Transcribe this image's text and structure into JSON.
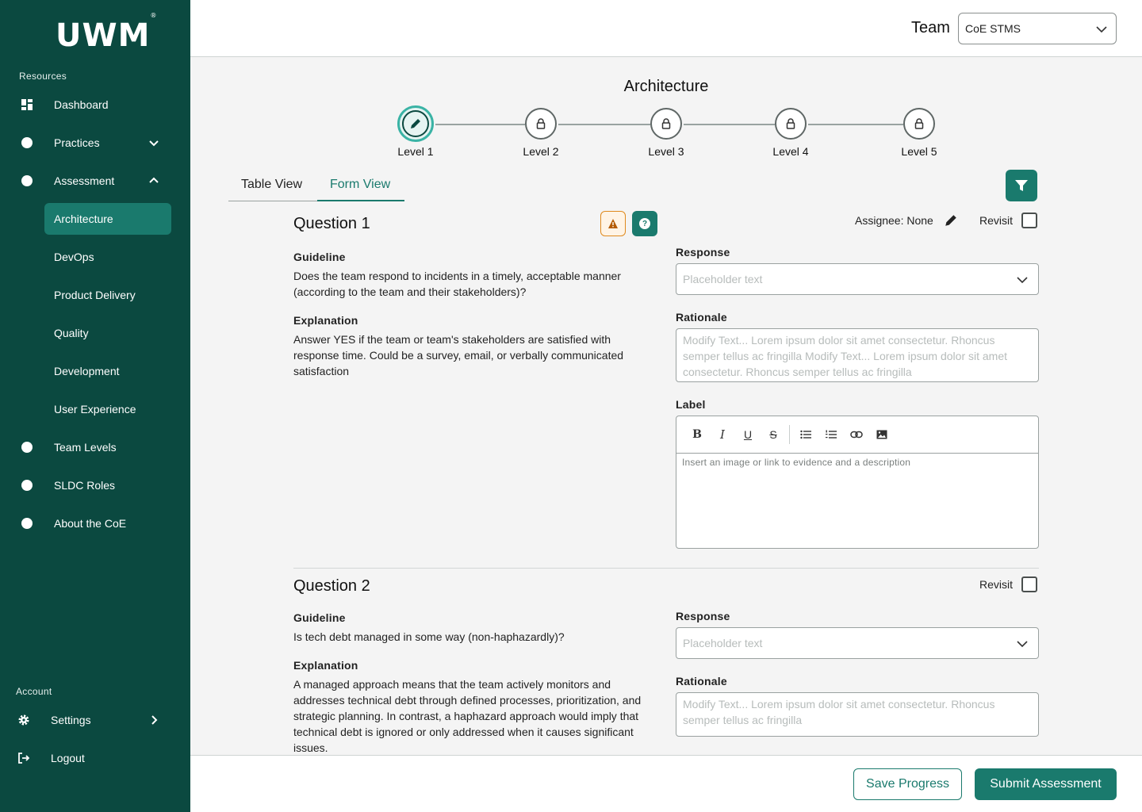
{
  "brand": {
    "logo_text": "UWM",
    "logo_mark": "®"
  },
  "sidebar": {
    "resources_label": "Resources",
    "account_label": "Account",
    "items": [
      {
        "label": "Dashboard",
        "icon": "dashboard-icon"
      },
      {
        "label": "Practices",
        "icon": "dot-icon",
        "chevron": "chevron-down-icon"
      },
      {
        "label": "Assessment",
        "icon": "dot-icon",
        "chevron": "chevron-up-icon"
      },
      {
        "label": "Team Levels",
        "icon": "dot-icon"
      },
      {
        "label": "SLDC Roles",
        "icon": "dot-icon"
      },
      {
        "label": "About the CoE",
        "icon": "dot-icon"
      }
    ],
    "sub_items": [
      {
        "label": "Architecture",
        "active": true
      },
      {
        "label": "DevOps"
      },
      {
        "label": "Product Delivery"
      },
      {
        "label": "Quality"
      },
      {
        "label": "Development"
      },
      {
        "label": "User Experience"
      }
    ],
    "account_items": [
      {
        "label": "Settings",
        "icon": "gear-icon"
      },
      {
        "label": "Logout",
        "icon": "logout-icon"
      }
    ]
  },
  "header": {
    "team_label": "Team",
    "team_value": "CoE STMS"
  },
  "main": {
    "title": "Architecture",
    "levels": [
      "Level 1",
      "Level 2",
      "Level 3",
      "Level 4",
      "Level 5"
    ],
    "current_level": 1,
    "tabs": [
      {
        "label": "Table View",
        "active": false
      },
      {
        "label": "Form View",
        "active": true
      }
    ]
  },
  "question1": {
    "title": "Question 1",
    "guideline_label": "Guideline",
    "guideline_text": "Does the team respond to incidents in a timely, acceptable manner (according to the team and their stakeholders)?",
    "explanation_label": "Explanation",
    "explanation_text": "Answer YES if the team or team's stakeholders are satisfied with response time. Could be a survey, email, or verbally communicated satisfaction",
    "assignee": "Assignee: None",
    "revisit_label": "Revisit",
    "revisit_checked": false,
    "response_label": "Response",
    "response_placeholder": "Placeholder text",
    "rationale_label": "Rationale",
    "rationale_text": "Modify Text... Lorem ipsum dolor sit amet consectetur. Rhoncus semper tellus ac fringilla Modify Text... Lorem ipsum dolor sit amet consectetur. Rhoncus semper tellus ac fringilla",
    "label_label": "Label",
    "editor_placeholder": "Insert an image or link to evidence and a description"
  },
  "question2": {
    "title": "Question 2",
    "guideline_label": "Guideline",
    "guideline_text": "Is tech debt managed in some way (non-haphazardly)?",
    "explanation_label": "Explanation",
    "explanation_text": "A managed approach means that the team actively monitors and addresses technical debt through defined processes, prioritization, and strategic planning. In contrast, a haphazard approach would imply that technical debt is ignored or only addressed when it causes significant issues.",
    "revisit_label": "Revisit",
    "revisit_checked": false,
    "response_label": "Response",
    "response_placeholder": "Placeholder text",
    "rationale_label": "Rationale",
    "rationale_text": "Modify Text... Lorem ipsum dolor sit amet consectetur. Rhoncus semper tellus ac fringilla"
  },
  "footer": {
    "save_label": "Save Progress",
    "submit_label": "Submit Assessment"
  },
  "colors": {
    "sidebar_bg": "#0b4940",
    "accent": "#1a7a6d",
    "warning": "#e08a1e"
  }
}
